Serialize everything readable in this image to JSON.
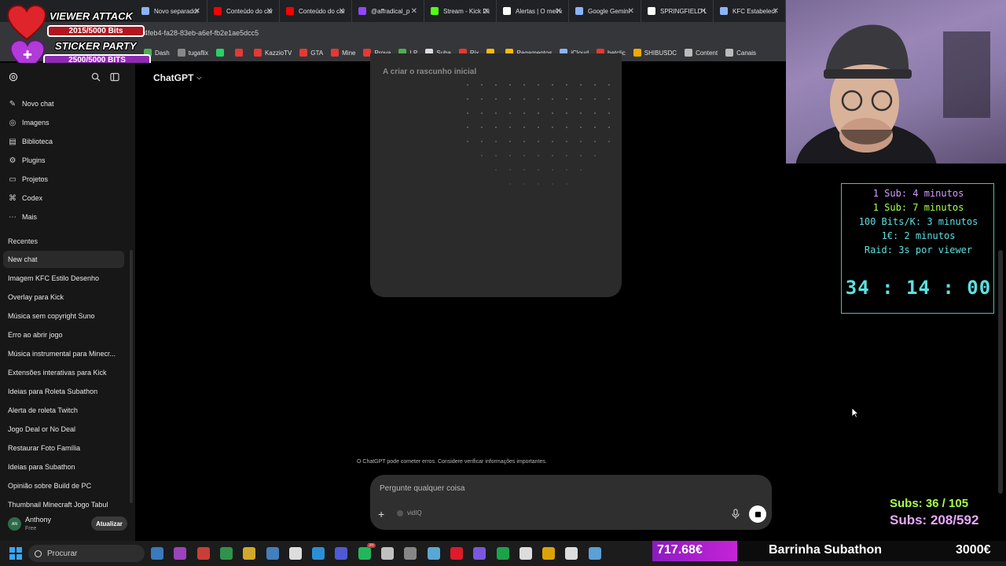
{
  "colors": {
    "sidebar_bg": "#171717",
    "main_bg": "#000000",
    "composer_bg": "#2f2f2f",
    "timer_accent": "#5de0e0",
    "subs_green": "#a8ff4a",
    "subs_pink": "#e8a8ff",
    "subathon_fill": "#c623d8"
  },
  "browser": {
    "tabs": [
      {
        "label": "Novo separador",
        "icon": "newtab-icon",
        "color": "#8ab4f8"
      },
      {
        "label": "Conteúdo do can",
        "icon": "youtube-icon",
        "color": "#ff0000"
      },
      {
        "label": "Conteúdo do can",
        "icon": "youtube-icon",
        "color": "#ff0000"
      },
      {
        "label": "@affradical_p",
        "icon": "twitch-icon",
        "color": "#9146ff"
      },
      {
        "label": "Stream - Kick Da",
        "icon": "kick-icon",
        "color": "#53fc18"
      },
      {
        "label": "Alertas | O melho",
        "icon": "alert-icon",
        "color": "#ffffff"
      },
      {
        "label": "Google Gemini",
        "icon": "gemini-icon",
        "color": "#8ab4f8"
      },
      {
        "label": "SPRINGFIELD LA",
        "icon": "google-icon",
        "color": "#ffffff"
      },
      {
        "label": "KFC Estabeleci",
        "icon": "gemini-icon",
        "color": "#8ab4f8"
      }
    ],
    "url_fragment": "4feb4-fa28-83eb-a6ef-fb2e1ae5dcc5",
    "bookmarks": [
      {
        "label": "Dash",
        "color": "#4caf50"
      },
      {
        "label": "tugaflix",
        "color": "#888888"
      },
      {
        "label": "",
        "color": "#25d366"
      },
      {
        "label": "",
        "color": "#e53935"
      },
      {
        "label": "KazzioTV",
        "color": "#e53935"
      },
      {
        "label": "GTA",
        "color": "#e53935"
      },
      {
        "label": "Mine",
        "color": "#e53935"
      },
      {
        "label": "Prova",
        "color": "#e53935"
      },
      {
        "label": "LP",
        "color": "#4caf50"
      },
      {
        "label": "Suba",
        "color": "#dddddd"
      },
      {
        "label": "Rix",
        "color": "#e53935"
      },
      {
        "label": "",
        "color": "#fbbc04"
      },
      {
        "label": "Pagamentos",
        "color": "#fbbc04"
      },
      {
        "label": "iCloud",
        "color": "#8ab4f8"
      },
      {
        "label": "betclic",
        "color": "#e53935"
      },
      {
        "label": "SHIBUSDC",
        "color": "#f2a900"
      },
      {
        "label": "Content",
        "color": "#bbbbbb"
      },
      {
        "label": "Canais",
        "color": "#bbbbbb"
      }
    ]
  },
  "overlay": {
    "viewer_attack": "VIEWER ATTACK",
    "viewer_bits": "2015/5000 Bits",
    "sticker_party": "STICKER PARTY",
    "sticker_bits": "2500/5000 BITS"
  },
  "sidebar": {
    "nav": [
      {
        "label": "Novo chat",
        "icon": "new-chat-icon",
        "glyph": "✎"
      },
      {
        "label": "Imagens",
        "icon": "images-icon",
        "glyph": "◎"
      },
      {
        "label": "Biblioteca",
        "icon": "library-icon",
        "glyph": "▤"
      },
      {
        "label": "Plugins",
        "icon": "plugins-icon",
        "glyph": "⚙"
      },
      {
        "label": "Projetos",
        "icon": "projects-icon",
        "glyph": "▭"
      },
      {
        "label": "Codex",
        "icon": "codex-icon",
        "glyph": "⌘"
      },
      {
        "label": "Mais",
        "icon": "more-icon",
        "glyph": "⋯"
      }
    ],
    "recents_label": "Recentes",
    "recents": [
      "New chat",
      "Imagem KFC Estilo Desenho",
      "Overlay para Kick",
      "Música sem copyright Suno",
      "Erro ao abrir jogo",
      "Música instrumental para Minecr...",
      "Extensões interativas para Kick",
      "Ideias para Roleta Subathon",
      "Alerta de roleta Twitch",
      "Jogo Deal or No Deal",
      "Restaurar Foto Família",
      "Ideias para Subathon",
      "Opinião sobre Build de PC",
      "Thumbnail Minecraft Jogo Tabul"
    ],
    "user": {
      "initials": "AN",
      "name": "Anthony",
      "plan": "Free",
      "upgrade_label": "Atualizar"
    }
  },
  "main": {
    "model_name": "ChatGPT",
    "draft_label": "A criar o rascunho inicial",
    "disclaimer": "O ChatGPT pode cometer erros. Considere verificar informações importantes.",
    "composer": {
      "placeholder": "Pergunte qualquer coisa",
      "tool_chip": "vidIQ"
    }
  },
  "stream": {
    "rules": [
      {
        "text": "1 Sub: 4 minutos",
        "color": "#d49bff"
      },
      {
        "text": "1 Sub: 7 minutos",
        "color": "#a8ff4a"
      },
      {
        "text": "100 Bits/K: 3 minutos",
        "color": "#5de0e0"
      },
      {
        "text": "1€: 2 minutos",
        "color": "#5de0e0"
      },
      {
        "text": "Raid: 3s por viewer",
        "color": "#5de0e0"
      }
    ],
    "countdown": "34 : 14 : 00",
    "subs_a": "Subs: 36 / 105",
    "subs_b": "Subs: 208/592"
  },
  "taskbar": {
    "search_label": "Procurar",
    "apps": [
      {
        "name": "photos-icon",
        "color": "#3d8bd8"
      },
      {
        "name": "camera-icon",
        "color": "#b04ad8"
      },
      {
        "name": "chrome-icon",
        "color": "#e8453c"
      },
      {
        "name": "chrome-alt-icon",
        "color": "#34a853"
      },
      {
        "name": "folder-icon",
        "color": "#f2c12e"
      },
      {
        "name": "calculator-icon",
        "color": "#4a90d9"
      },
      {
        "name": "capcut-icon",
        "color": "#ffffff"
      },
      {
        "name": "photoshop-icon",
        "color": "#2fa3f7"
      },
      {
        "name": "discord-icon",
        "color": "#5865f2"
      },
      {
        "name": "whatsapp-icon",
        "color": "#25d366"
      },
      {
        "name": "epic-icon",
        "color": "#dddddd"
      },
      {
        "name": "obs-icon",
        "color": "#999999"
      },
      {
        "name": "steam-icon",
        "color": "#66c0f4"
      },
      {
        "name": "opera-icon",
        "color": "#ff1b2d"
      },
      {
        "name": "apps-icon",
        "color": "#8a63ff"
      },
      {
        "name": "spotify-icon",
        "color": "#1db954"
      },
      {
        "name": "kick-app-icon",
        "color": "#ffffff"
      },
      {
        "name": "drive-icon",
        "color": "#fbbc04"
      },
      {
        "name": "capcut-alt-icon",
        "color": "#ffffff"
      },
      {
        "name": "notepad-icon",
        "color": "#67b7f7"
      }
    ],
    "whatsapp_badge": "36",
    "subathon": {
      "amount": "717.68€",
      "title": "Barrinha Subathon",
      "goal": "3000€",
      "progress_fraction": 0.239
    }
  }
}
